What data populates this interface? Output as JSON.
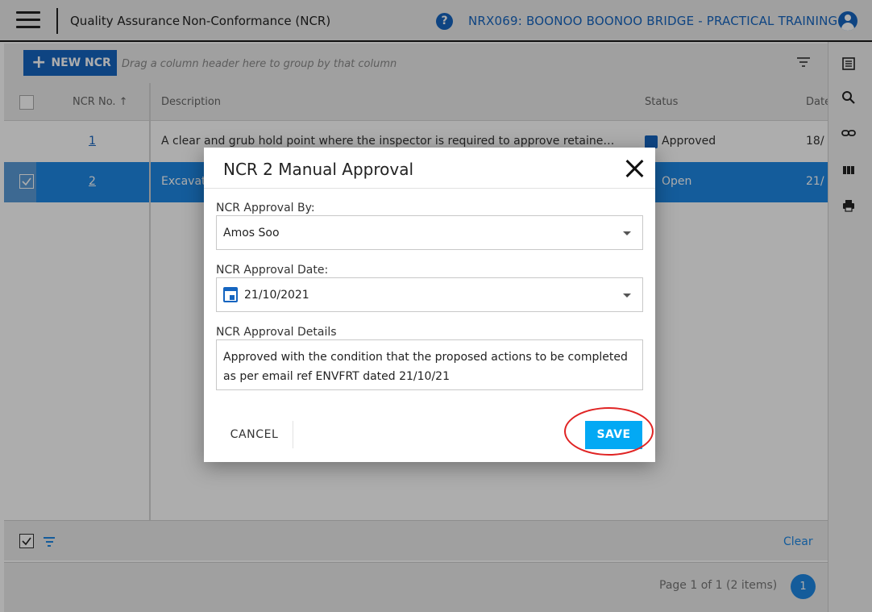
{
  "header": {
    "module": "Quality Assurance",
    "page": "Non-Conformance (NCR)",
    "project": "NRX069: BOONOO BOONOO BRIDGE - PRACTICAL TRAINING"
  },
  "toolbar": {
    "new_label": "NEW NCR",
    "group_hint": "Drag a column header here to group by that column"
  },
  "grid": {
    "columns": [
      "NCR No. ↑",
      "Description",
      "Status",
      "Date"
    ],
    "rows": [
      {
        "no": "1",
        "description": "A clear and grub hold point where the inspector is required to approve retaine…",
        "status": "Approved",
        "date": "18/",
        "selected": false
      },
      {
        "no": "2",
        "description": "Excavat",
        "status": "Open",
        "date": "21/",
        "selected": true
      }
    ]
  },
  "footer": {
    "clear_label": "Clear",
    "page_info": "Page 1 of 1 (2 items)",
    "page_number": "1"
  },
  "dialog": {
    "title": "NCR 2 Manual Approval",
    "approval_by_label": "NCR Approval By:",
    "approval_by_value": "Amos Soo",
    "approval_date_label": "NCR Approval Date:",
    "approval_date_value": "21/10/2021",
    "details_label": "NCR Approval Details",
    "details_value": "Approved with the condition that the proposed actions to be completed as per email ref ENVFRT dated  21/10/21",
    "cancel_label": "CANCEL",
    "save_label": "SAVE"
  },
  "colors": {
    "primary": "#1565c0",
    "row_selected": "#1e88e5",
    "save_button": "#03a9f4",
    "annotation": "#e02424"
  },
  "icons": [
    "menu-icon",
    "help-icon",
    "user-icon",
    "plus-icon",
    "filter-icon",
    "list-icon",
    "search-icon",
    "link-icon",
    "columns-icon",
    "print-icon",
    "calendar-icon",
    "close-icon"
  ]
}
